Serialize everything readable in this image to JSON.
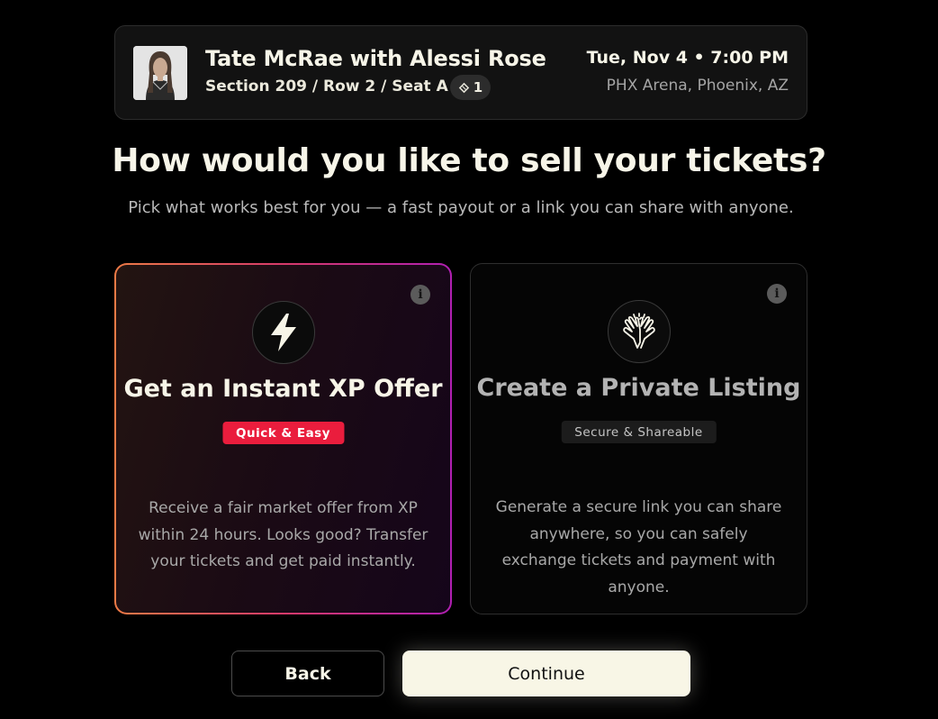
{
  "event": {
    "title": "Tate McRae with Alessi Rose",
    "seat": "Section 209 / Row 2 / Seat A",
    "ticket_count": "1",
    "date": "Tue, Nov 4 • 7:00 PM",
    "venue": "PHX Arena, Phoenix, AZ"
  },
  "heading": "How would you like to sell your tickets?",
  "subheading": "Pick what works best for you — a fast payout or a link you can share with anyone.",
  "options": [
    {
      "icon": "lightning-icon",
      "title": "Get an Instant XP Offer",
      "tag": "Quick & Easy",
      "description": "Receive a fair market offer from XP within 24 hours. Looks good? Transfer your tickets and get paid instantly.",
      "selected": true
    },
    {
      "icon": "high-five-icon",
      "title": "Create a Private Listing",
      "tag": "Secure & Shareable",
      "description": "Generate a secure link you can share anywhere, so you can safely exchange tickets and payment with anyone.",
      "selected": false
    }
  ],
  "buttons": {
    "back": "Back",
    "continue": "Continue"
  },
  "colors": {
    "accent_gradient_start": "#ed7a46",
    "accent_gradient_end": "#b01fb2",
    "tag_red": "#ea1d3d",
    "continue_bg": "#f8f6e6"
  }
}
